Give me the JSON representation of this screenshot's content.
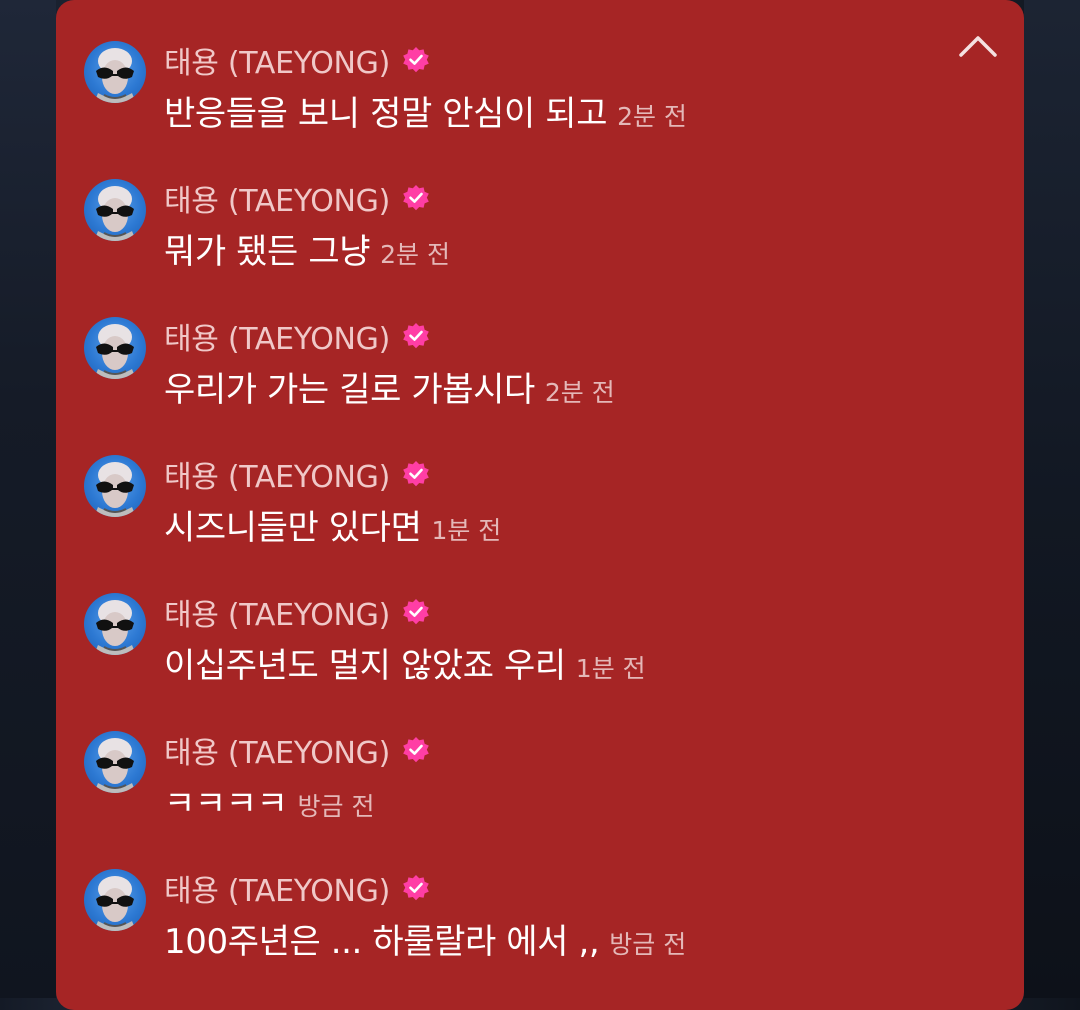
{
  "panel": {
    "background": "#a62525",
    "collapse_icon": "chevron-up-icon"
  },
  "accent": {
    "verified_badge": "#ff3ea5"
  },
  "comments": [
    {
      "author": "태용 (TAEYONG)",
      "verified": true,
      "message": "반응들을 보니 정말 안심이 되고",
      "time": "2분 전"
    },
    {
      "author": "태용 (TAEYONG)",
      "verified": true,
      "message": "뭐가 됐든 그냥",
      "time": "2분 전"
    },
    {
      "author": "태용 (TAEYONG)",
      "verified": true,
      "message": "우리가 가는 길로 가봅시다",
      "time": "2분 전"
    },
    {
      "author": "태용 (TAEYONG)",
      "verified": true,
      "message": "시즈니들만 있다면",
      "time": "1분 전"
    },
    {
      "author": "태용 (TAEYONG)",
      "verified": true,
      "message": "이십주년도 멀지 않았죠 우리",
      "time": "1분 전"
    },
    {
      "author": "태용 (TAEYONG)",
      "verified": true,
      "message": "ㅋㅋㅋㅋ",
      "time": "방금 전"
    },
    {
      "author": "태용 (TAEYONG)",
      "verified": true,
      "message": "100주년은 ... 하룰랄라 에서 ,,",
      "time": "방금 전"
    }
  ]
}
